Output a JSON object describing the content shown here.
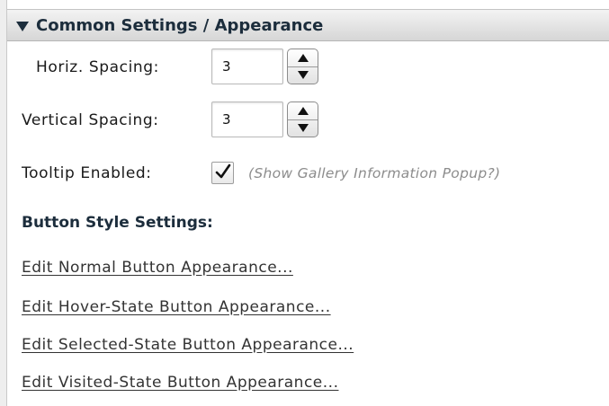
{
  "section": {
    "title": "Common Settings / Appearance",
    "expanded": true
  },
  "fields": {
    "horiz_spacing": {
      "label": "Horiz. Spacing:",
      "value": "3"
    },
    "vertical_spacing": {
      "label": "Vertical Spacing:",
      "value": "3"
    },
    "tooltip": {
      "label": "Tooltip Enabled:",
      "checked": true,
      "hint": "(Show Gallery Information Popup?)"
    }
  },
  "button_styles": {
    "heading": "Button Style Settings:",
    "links": [
      "Edit Normal Button Appearance...",
      "Edit Hover-State Button Appearance...",
      "Edit Selected-State Button Appearance...",
      "Edit Visited-State Button Appearance..."
    ]
  },
  "colors": {
    "header_text": "#1c2d3c",
    "link_text": "#333333",
    "hint_text": "#8c8c8c"
  },
  "icons": {
    "collapse": "triangle-down-icon",
    "stepper_up": "arrow-up-icon",
    "stepper_down": "arrow-down-icon",
    "checkmark": "checkmark-icon"
  }
}
